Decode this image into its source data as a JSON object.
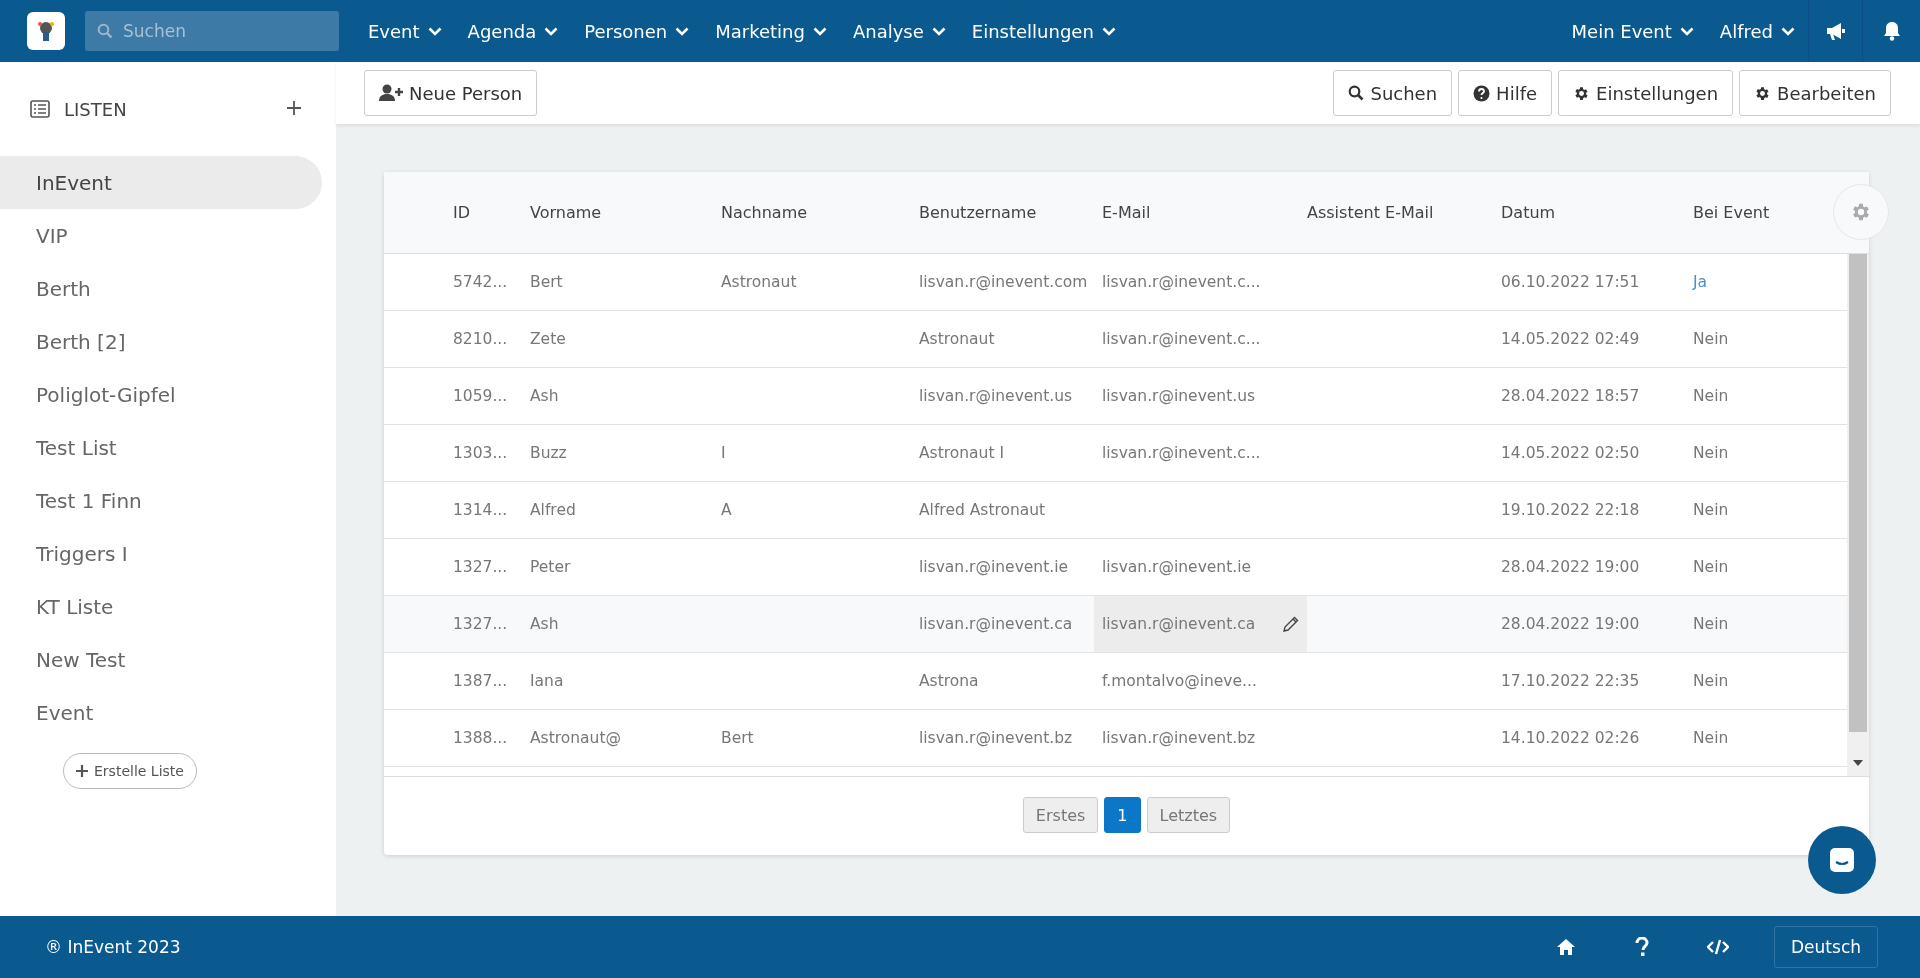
{
  "topbar": {
    "search": {
      "placeholder": "Suchen"
    },
    "nav": [
      {
        "label": "Event"
      },
      {
        "label": "Agenda"
      },
      {
        "label": "Personen"
      },
      {
        "label": "Marketing"
      },
      {
        "label": "Analyse"
      },
      {
        "label": "Einstellungen"
      }
    ],
    "right_menus": [
      {
        "label": "Mein Event"
      },
      {
        "label": "Alfred"
      }
    ]
  },
  "sidebar": {
    "title": "LISTEN",
    "items": [
      {
        "label": "InEvent",
        "selected": true
      },
      {
        "label": "VIP",
        "selected": false
      },
      {
        "label": "Berth",
        "selected": false
      },
      {
        "label": "Berth [2]",
        "selected": false
      },
      {
        "label": "Poliglot-Gipfel",
        "selected": false
      },
      {
        "label": "Test List",
        "selected": false
      },
      {
        "label": "Test 1 Finn",
        "selected": false
      },
      {
        "label": "Triggers I",
        "selected": false
      },
      {
        "label": "KT Liste",
        "selected": false
      },
      {
        "label": "New Test",
        "selected": false
      },
      {
        "label": "Event",
        "selected": false
      }
    ],
    "create_button": "Erstelle Liste"
  },
  "toolbar": {
    "new_button": "Neue Person",
    "buttons": [
      {
        "kind": "search",
        "label": "Suchen"
      },
      {
        "kind": "help",
        "label": "Hilfe"
      },
      {
        "kind": "settings",
        "label": "Einstellungen"
      },
      {
        "kind": "settings",
        "label": "Bearbeiten"
      }
    ]
  },
  "table": {
    "columns": [
      "ID",
      "Vorname",
      "Nachname",
      "Benutzername",
      "E-Mail",
      "Assistent E-Mail",
      "Datum",
      "Bei Event"
    ],
    "rows": [
      {
        "cells": [
          "5742...",
          "Bert",
          "Astronaut",
          "lisvan.r@inevent.com",
          "lisvan.r@inevent.c...",
          "",
          "06.10.2022 17:51",
          "Ja"
        ],
        "at_event": true,
        "highlighted": false
      },
      {
        "cells": [
          "8210...",
          "Zete",
          "",
          "Astronaut",
          "lisvan.r@inevent.c...",
          "",
          "14.05.2022 02:49",
          "Nein"
        ],
        "at_event": false,
        "highlighted": false
      },
      {
        "cells": [
          "1059...",
          "Ash",
          "",
          "lisvan.r@inevent.us",
          "lisvan.r@inevent.us",
          "",
          "28.04.2022 18:57",
          "Nein"
        ],
        "at_event": false,
        "highlighted": false
      },
      {
        "cells": [
          "1303...",
          "Buzz",
          "I",
          "Astronaut I",
          "lisvan.r@inevent.c...",
          "",
          "14.05.2022 02:50",
          "Nein"
        ],
        "at_event": false,
        "highlighted": false
      },
      {
        "cells": [
          "1314...",
          "Alfred",
          "A",
          "Alfred Astronaut",
          "",
          "",
          "19.10.2022 22:18",
          "Nein"
        ],
        "at_event": false,
        "highlighted": false
      },
      {
        "cells": [
          "1327...",
          "Peter",
          "",
          "lisvan.r@inevent.ie",
          "lisvan.r@inevent.ie",
          "",
          "28.04.2022 19:00",
          "Nein"
        ],
        "at_event": false,
        "highlighted": false
      },
      {
        "cells": [
          "1327...",
          "Ash",
          "",
          "lisvan.r@inevent.ca",
          "lisvan.r@inevent.ca",
          "",
          "28.04.2022 19:00",
          "Nein"
        ],
        "at_event": false,
        "highlighted": true
      },
      {
        "cells": [
          "1387...",
          "Iana",
          "",
          "Astrona",
          "f.montalvo@ineve...",
          "",
          "17.10.2022 22:35",
          "Nein"
        ],
        "at_event": false,
        "highlighted": false
      },
      {
        "cells": [
          "1388...",
          "Astronaut@",
          "Bert",
          "lisvan.r@inevent.bz",
          "lisvan.r@inevent.bz",
          "",
          "14.10.2022 02:26",
          "Nein"
        ],
        "at_event": false,
        "highlighted": false
      }
    ],
    "pagination": [
      {
        "label": "Erstes",
        "selected": false
      },
      {
        "label": "1",
        "selected": true
      },
      {
        "label": "Letztes",
        "selected": false
      }
    ]
  },
  "footer": {
    "copyright": "® InEvent 2023",
    "language": "Deutsch"
  }
}
